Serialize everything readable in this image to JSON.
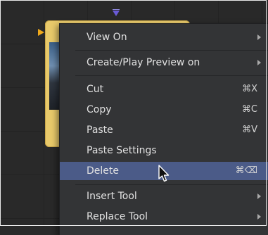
{
  "menu": {
    "items": [
      {
        "label": "View On",
        "submenu": true
      },
      {
        "label": "Create/Play Preview on",
        "submenu": true
      },
      {
        "label": "Cut",
        "shortcut": "⌘X"
      },
      {
        "label": "Copy",
        "shortcut": "⌘C"
      },
      {
        "label": "Paste",
        "shortcut": "⌘V"
      },
      {
        "label": "Paste Settings"
      },
      {
        "label": "Delete",
        "shortcut": "⌘⌫",
        "highlighted": true
      },
      {
        "label": "Insert Tool",
        "submenu": true
      },
      {
        "label": "Replace Tool",
        "submenu": true
      }
    ]
  },
  "colors": {
    "menu_bg": "#333436",
    "highlight": "#4b5b88",
    "node_fill": "#e8c96a",
    "input_arrow": "#f0a91a",
    "output_arrow": "#6a5bd8"
  },
  "icons": [
    "submenu-arrow-icon",
    "mouse-pointer-icon"
  ]
}
